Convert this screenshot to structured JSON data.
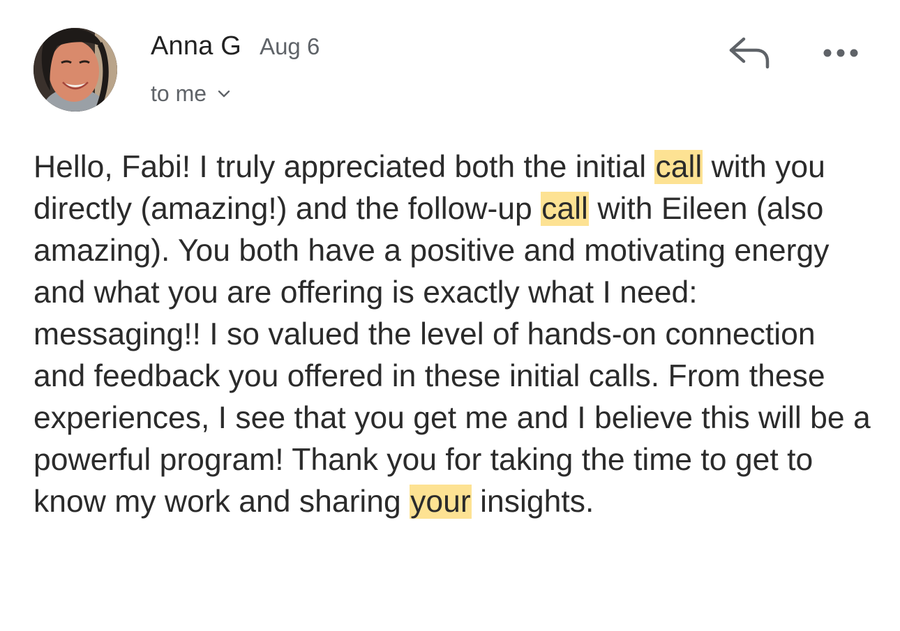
{
  "message": {
    "sender": {
      "name": "Anna G",
      "date": "Aug 6",
      "avatar_icon": "profile-photo"
    },
    "recipient": {
      "label": "to me",
      "expand_icon": "chevron-down-icon"
    },
    "actions": {
      "reply_icon": "reply-arrow-icon",
      "more_icon": "more-horizontal-icon"
    },
    "highlight_color": "#fde293",
    "body": {
      "seg1": "Hello, Fabi! I truly appreciated both the initial ",
      "hl1": "call",
      "seg2": " with you directly (amazing!) and the follow-up ",
      "hl2": "call",
      "seg3": " with Eileen (also amazing). You both have a positive and motivating energy and what you are offering is exactly what I need: messaging!! I so valued the level of hands-on connection and feedback you offered in these initial calls. From these experiences, I see that you get me and I believe this will be a powerful program! Thank you for taking the time to get to know my work and sharing ",
      "hl3": "your",
      "seg4": " insights."
    }
  }
}
